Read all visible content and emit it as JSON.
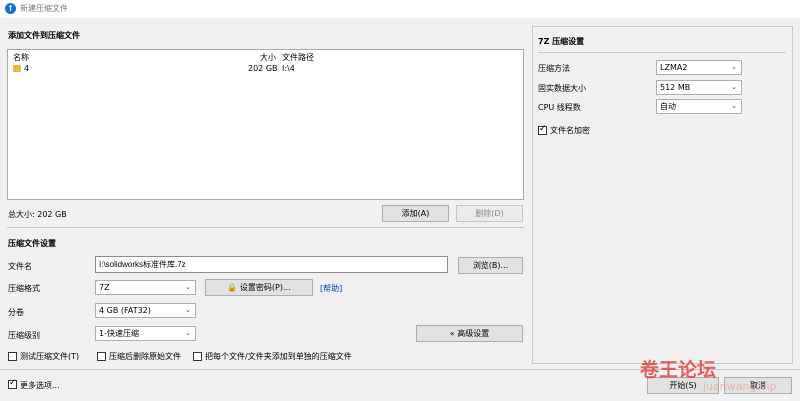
{
  "window": {
    "title": "新建压缩文件"
  },
  "add_section": {
    "title": "添加文件到压缩文件",
    "columns": {
      "name": "名称",
      "size": "大小",
      "path": "文件路径"
    },
    "rows": [
      {
        "name": "4",
        "size": "202 GB",
        "path": "I:\\4"
      }
    ],
    "total": "总大小: 202 GB",
    "add_button": "添加(A)",
    "delete_button": "删除(D)"
  },
  "settings": {
    "title": "压缩文件设置",
    "filename_label": "文件名",
    "filename_value": "I:\\solidworks标准件库.7z",
    "browse_button": "浏览(B)...",
    "format_label": "压缩格式",
    "format_value": "7Z",
    "password_button": "设置密码(P)...",
    "help_link": "[帮助]",
    "split_label": "分卷",
    "split_value": "4 GB (FAT32)",
    "level_label": "压缩级别",
    "level_value": "1-快速压缩",
    "advanced_button": "« 高级设置",
    "test_label": "测试压缩文件(T)",
    "delete_after_label": "压缩后删除原始文件",
    "separate_label": "把每个文件/文件夹添加到单独的压缩文件"
  },
  "sevenz": {
    "title": "7Z 压缩设置",
    "method_label": "压缩方法",
    "method_value": "LZMA2",
    "solid_label": "固实数据大小",
    "solid_value": "512 MB",
    "cpu_label": "CPU 线程数",
    "cpu_value": "自动",
    "encrypt_label": "文件名加密",
    "encrypt_checked": true
  },
  "footer": {
    "more_label": "更多选项...",
    "more_checked": true,
    "start_button": "开始(S)",
    "cancel_button": "取消"
  },
  "watermark": {
    "text": "卷王论坛",
    "sub": "juanwang.vip"
  }
}
